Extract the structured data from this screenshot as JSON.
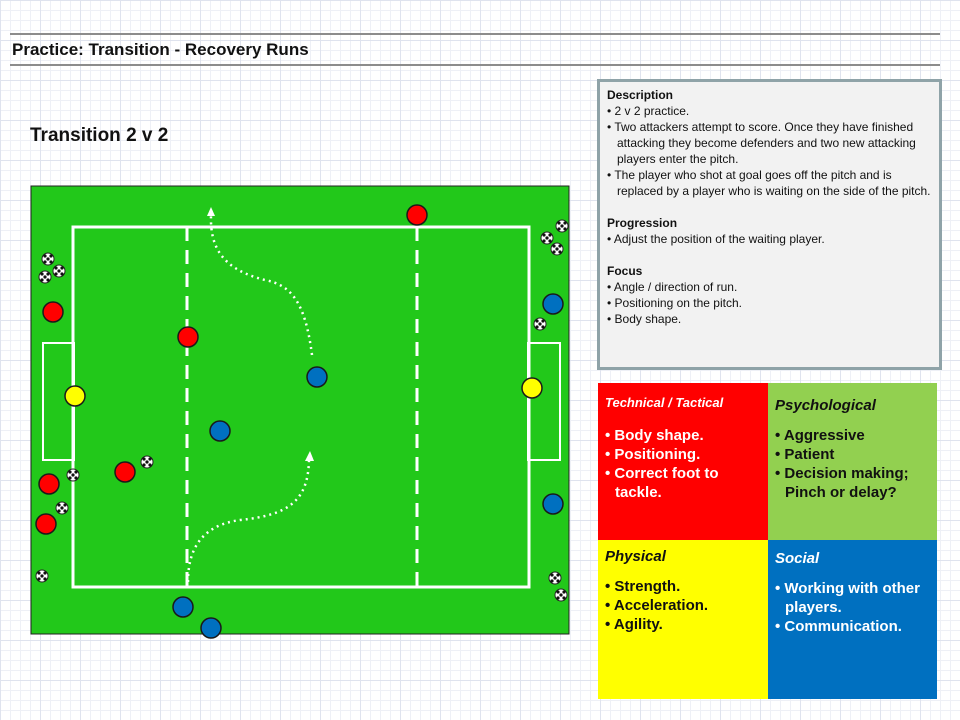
{
  "header": {
    "title": "Practice: Transition - Recovery Runs"
  },
  "drill": {
    "subtitle": "Transition 2 v 2"
  },
  "description": {
    "heading": "Description",
    "bullets": [
      "• 2 v 2 practice.",
      "• Two attackers attempt to score. Once they have finished attacking they become defenders and two new attacking players enter the pitch.",
      "• The player who shot at goal goes off the pitch and is replaced by a player who is waiting on the side of the pitch."
    ],
    "progression_heading": "Progression",
    "progression": [
      "•   Adjust the position of the waiting player."
    ],
    "focus_heading": "Focus",
    "focus": [
      "•   Angle / direction of run.",
      "•   Positioning on the pitch.",
      "•   Body shape."
    ]
  },
  "quadrants": {
    "technical": {
      "title": "Technical / Tactical",
      "items": [
        "• Body shape.",
        "• Positioning.",
        "• Correct foot to tackle."
      ]
    },
    "psychological": {
      "title": "Psychological",
      "items": [
        "• Aggressive",
        "• Patient",
        "• Decision making; Pinch or delay?"
      ]
    },
    "physical": {
      "title": "Physical",
      "items": [
        "• Strength.",
        "• Acceleration.",
        "• Agility."
      ]
    },
    "social": {
      "title": "Social",
      "items": [
        "• Working with other players.",
        "• Communication."
      ]
    }
  },
  "colors": {
    "pitch": "#22c81a",
    "red_player": "#ff0000",
    "blue_player": "#0070c0",
    "goalkeeper": "#ffff00",
    "technical_bg": "#ff0000",
    "psychological_bg": "#92d050",
    "physical_bg": "#ffff00",
    "social_bg": "#0070c0"
  }
}
